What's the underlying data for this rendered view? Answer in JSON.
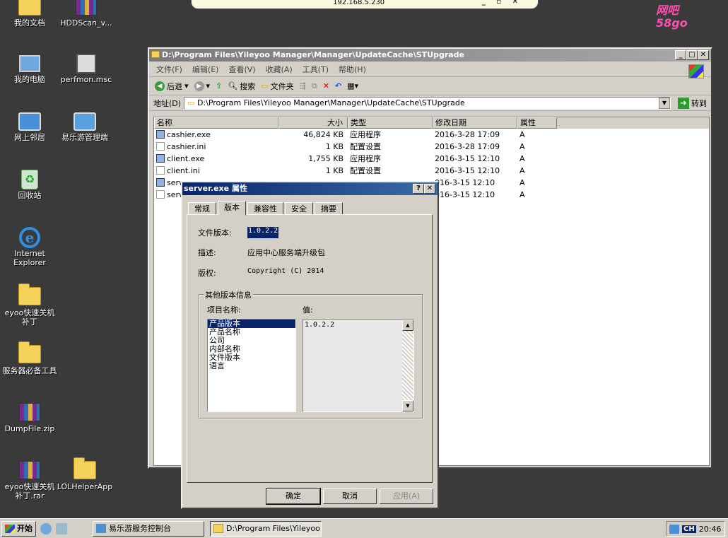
{
  "desktop": {
    "icons": [
      {
        "label": "我的文档",
        "icon": "folder-icon"
      },
      {
        "label": "HDDScan_v...",
        "icon": "rar-archive-icon"
      },
      {
        "label": "我的电脑",
        "icon": "computer-icon"
      },
      {
        "label": "perfmon.msc",
        "icon": "perfmon-icon"
      },
      {
        "label": "网上邻居",
        "icon": "network-icon"
      },
      {
        "label": "易乐游管理端",
        "icon": "network-admin-icon"
      },
      {
        "label": "回收站",
        "icon": "recycle-bin-icon"
      },
      {
        "label": "Internet Explorer",
        "icon": "ie-icon"
      },
      {
        "label": "eyoo快速关机补丁",
        "icon": "folder-icon"
      },
      {
        "label": "服务器必备工具",
        "icon": "folder-icon"
      },
      {
        "label": "DumpFile.zip",
        "icon": "rar-archive-icon"
      },
      {
        "label": "eyoo快速关机补丁.rar",
        "icon": "rar-archive-icon"
      },
      {
        "label": "LOLHelperApp",
        "icon": "folder-icon"
      }
    ]
  },
  "remote_bar": {
    "ip": "192.168.5.230",
    "controls": "_ ▫ ✕"
  },
  "logo": {
    "line1": "网吧",
    "line2": "58go"
  },
  "explorer": {
    "title": "D:\\Program Files\\Yileyoo Manager\\Manager\\UpdateCache\\STUpgrade",
    "menu": [
      "文件(F)",
      "编辑(E)",
      "查看(V)",
      "收藏(A)",
      "工具(T)",
      "帮助(H)"
    ],
    "toolbar": {
      "back": "后退",
      "search": "搜索",
      "folders": "文件夹"
    },
    "address_label": "地址(D)",
    "address": "D:\\Program Files\\Yileyoo Manager\\Manager\\UpdateCache\\STUpgrade",
    "goto": "转到",
    "columns": [
      "名称",
      "大小",
      "类型",
      "修改日期",
      "属性"
    ],
    "files": [
      {
        "name": "cashier.exe",
        "size": "46,824 KB",
        "type": "应用程序",
        "date": "2016-3-28 17:09",
        "attr": "A",
        "kind": "exe"
      },
      {
        "name": "cashier.ini",
        "size": "1 KB",
        "type": "配置设置",
        "date": "2016-3-28 17:09",
        "attr": "A",
        "kind": "ini"
      },
      {
        "name": "client.exe",
        "size": "1,755 KB",
        "type": "应用程序",
        "date": "2016-3-15 12:10",
        "attr": "A",
        "kind": "exe"
      },
      {
        "name": "client.ini",
        "size": "1 KB",
        "type": "配置设置",
        "date": "2016-3-15 12:10",
        "attr": "A",
        "kind": "ini"
      },
      {
        "name": "serv",
        "size": "",
        "type": "",
        "date": "016-3-15 12:10",
        "attr": "A",
        "kind": "exe"
      },
      {
        "name": "serv",
        "size": "",
        "type": "",
        "date": "016-3-15 12:10",
        "attr": "A",
        "kind": "ini"
      }
    ]
  },
  "dialog": {
    "title": "server.exe 属性",
    "title_buttons": [
      "?",
      "✕"
    ],
    "tabs": [
      "常规",
      "版本",
      "兼容性",
      "安全",
      "摘要"
    ],
    "file_version_label": "文件版本:",
    "file_version": "1.0.2.2",
    "description_label": "描述:",
    "description": "应用中心服务端升级包",
    "copyright_label": "版权:",
    "copyright": "Copyright (C) 2014",
    "group_label": "其他版本信息",
    "item_name_label": "项目名称:",
    "value_label": "值:",
    "items": [
      "产品版本",
      "产品名称",
      "公司",
      "内部名称",
      "文件版本",
      "语言"
    ],
    "value": "1.0.2.2",
    "buttons": {
      "ok": "确定",
      "cancel": "取消",
      "apply": "应用(A)"
    }
  },
  "taskbar": {
    "start": "开始",
    "tasks": [
      "易乐游服务控制台",
      "D:\\Program Files\\Yileyoo ..."
    ],
    "ime": "CH",
    "clock": "20:46"
  }
}
